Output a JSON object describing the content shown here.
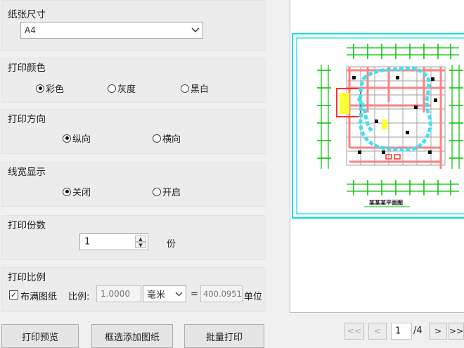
{
  "paper_size": {
    "title": "纸张尺寸",
    "selected": "A4"
  },
  "print_color": {
    "title": "打印颜色",
    "options": [
      "彩色",
      "灰度",
      "黑白"
    ],
    "selected_index": 0
  },
  "orientation": {
    "title": "打印方向",
    "options": [
      "纵向",
      "横向"
    ],
    "selected_index": 0
  },
  "line_width": {
    "title": "线宽显示",
    "options": [
      "关闭",
      "开启"
    ],
    "selected_index": 0
  },
  "copies": {
    "title": "打印份数",
    "value": "1",
    "unit": "份"
  },
  "scale": {
    "title": "打印比例",
    "fit_label": "布满图纸",
    "fit_checked": true,
    "ratio_label": "比例:",
    "ratio_value": "1.0000",
    "unit_selected": "毫米",
    "equals": "=",
    "result_value": "400.0951",
    "result_unit": "单位"
  },
  "buttons": {
    "preview": "打印预览",
    "frame_add": "框选添加图纸",
    "batch": "批量打印"
  },
  "pagination": {
    "first": "<<",
    "prev": "<",
    "current": "1",
    "total": "/4",
    "next": ">",
    "last": ">>"
  },
  "drawing": {
    "title_text": "某某某平面图"
  },
  "colors": {
    "frame": "#00e0e0",
    "grid": "#00c000",
    "wall": "#ff8080",
    "accent": "#ffff33"
  }
}
